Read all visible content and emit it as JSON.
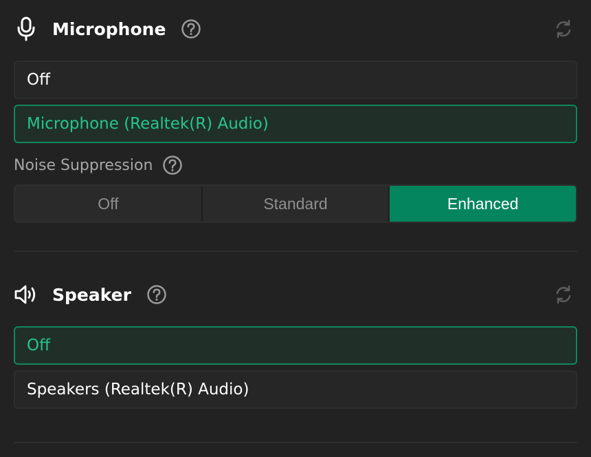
{
  "microphone": {
    "title": "Microphone",
    "icon": "microphone-icon",
    "help_icon": "help-circle-icon",
    "refresh_icon": "refresh-icon",
    "options": [
      {
        "label": "Off",
        "selected": false
      },
      {
        "label": "Microphone (Realtek(R) Audio)",
        "selected": true
      }
    ],
    "noise_suppression": {
      "label": "Noise Suppression",
      "options": [
        "Off",
        "Standard",
        "Enhanced"
      ],
      "selected": "Enhanced"
    }
  },
  "speaker": {
    "title": "Speaker",
    "icon": "speaker-icon",
    "help_icon": "help-circle-icon",
    "refresh_icon": "refresh-icon",
    "options": [
      {
        "label": "Off",
        "selected": true
      },
      {
        "label": "Speakers (Realtek(R) Audio)",
        "selected": false
      }
    ]
  },
  "colors": {
    "background": "#222222",
    "accent": "#04855e",
    "accent_text": "#27c48c",
    "selected_bg": "#203029"
  }
}
